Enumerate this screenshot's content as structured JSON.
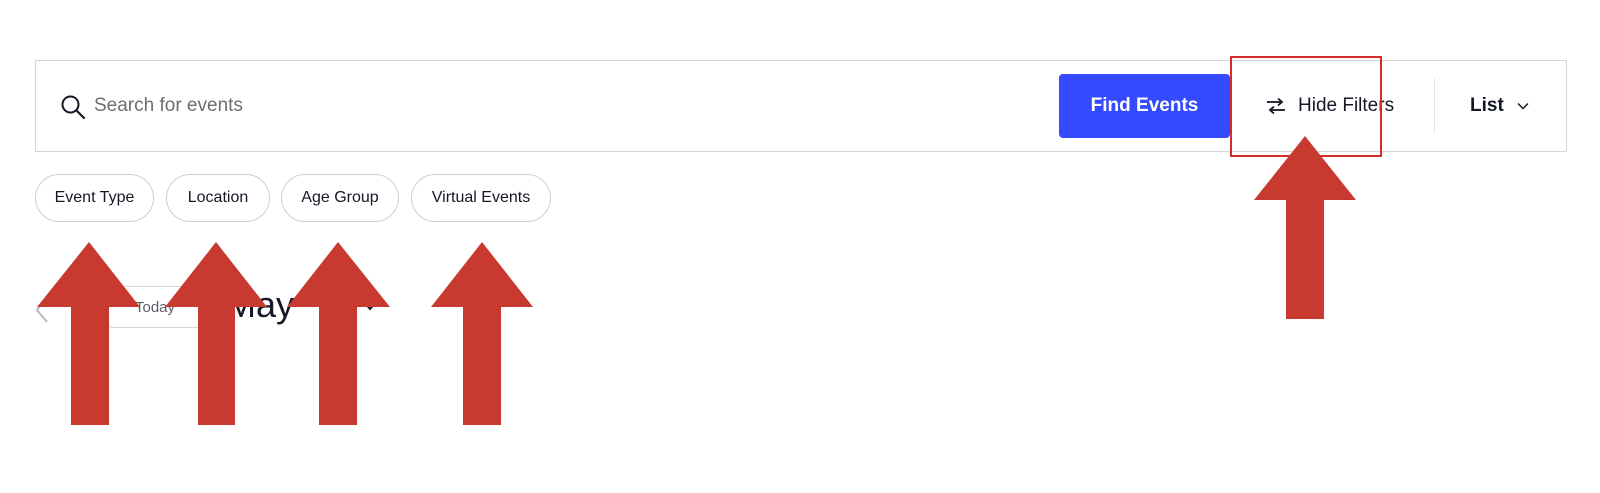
{
  "search": {
    "placeholder": "Search for events",
    "value": "",
    "find_button_label": "Find Events",
    "find_button_color": "#334aff"
  },
  "toolbar": {
    "hide_filters_label": "Hide Filters",
    "view_label": "List"
  },
  "filters": [
    {
      "label": "Event Type"
    },
    {
      "label": "Location"
    },
    {
      "label": "Age Group"
    },
    {
      "label": "Virtual Events"
    }
  ],
  "date_nav": {
    "today_label": "Today",
    "month_label": "May"
  },
  "annotations": {
    "arrow_color": "#c83a30",
    "highlight_color": "#d32c2c",
    "arrow_count": 5
  },
  "icons": {
    "search": "search-icon",
    "filter_toggle": "filter-toggle-icon",
    "view_chevron": "chevron-down-icon",
    "previous": "chevron-left-icon",
    "month_chevron": "chevron-down-icon"
  }
}
